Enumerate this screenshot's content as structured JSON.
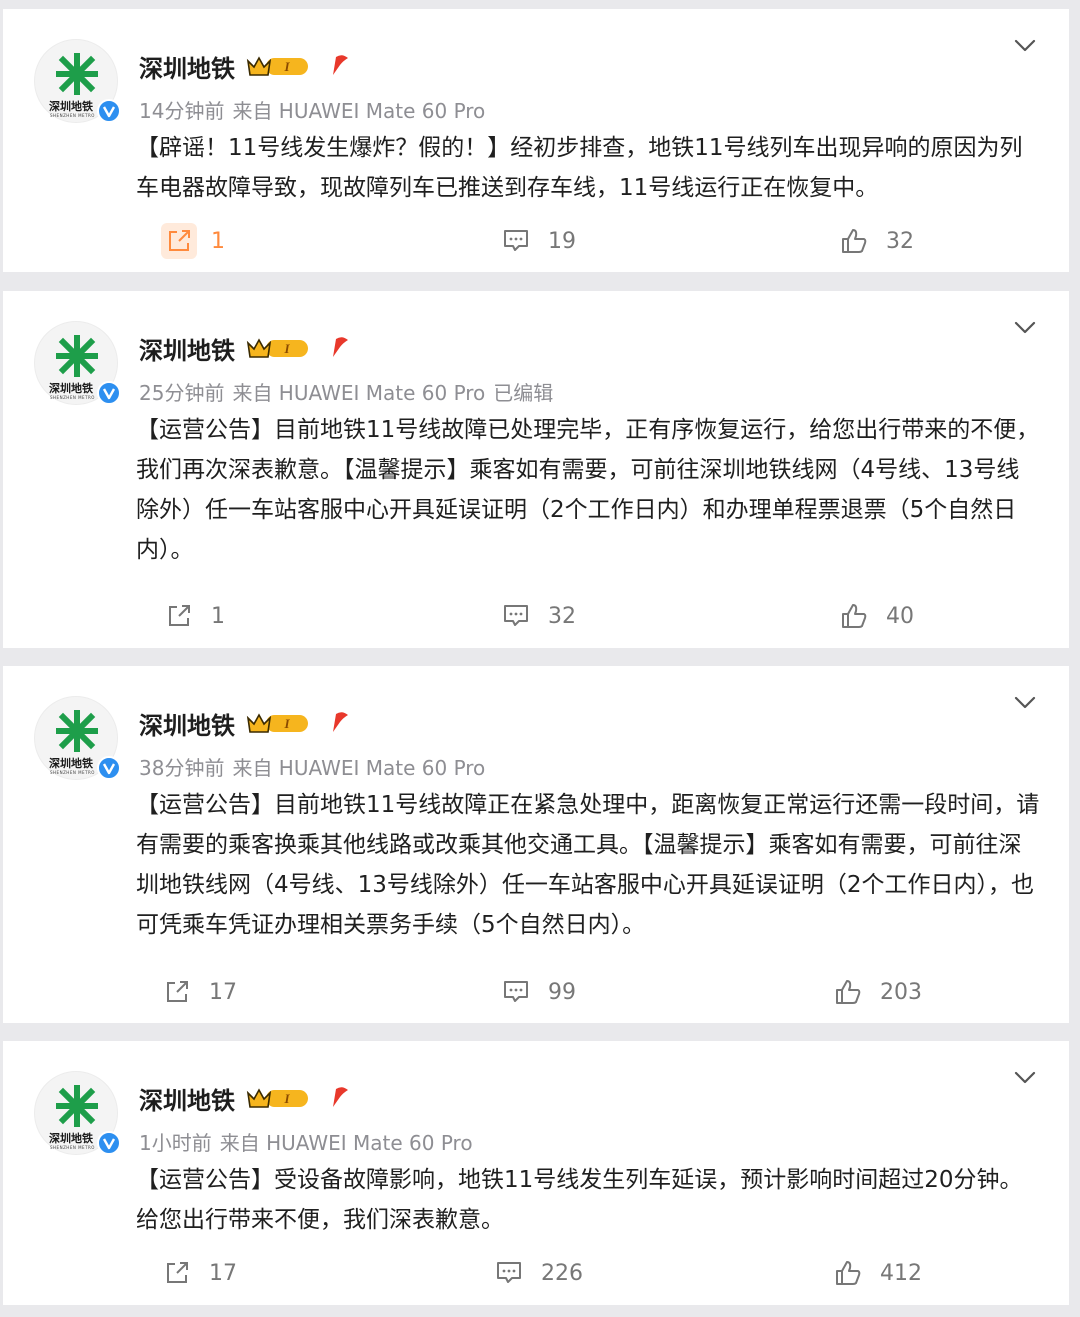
{
  "posts": [
    {
      "author": "深圳地铁",
      "vip_level": "I",
      "time": "14分钟前",
      "source": "来自 HUAWEI Mate 60 Pro",
      "edited": "",
      "content": "【辟谣！11号线发生爆炸？假的！】经初步排查，地铁11号线列车出现异响的原因为列车电器故障导致，现故障列车已推送到存车线，11号线运行正在恢复中。",
      "shares": "1",
      "comments": "19",
      "likes": "32"
    },
    {
      "author": "深圳地铁",
      "vip_level": "I",
      "time": "25分钟前",
      "source": "来自 HUAWEI Mate 60 Pro",
      "edited": "已编辑",
      "content": "【运营公告】目前地铁11号线故障已处理完毕，正有序恢复运行，给您出行带来的不便，我们再次深表歉意。【温馨提示】乘客如有需要，可前往深圳地铁线网（4号线、13号线除外）任一车站客服中心开具延误证明（2个工作日内）和办理单程票退票（5个自然日内）。",
      "shares": "1",
      "comments": "32",
      "likes": "40"
    },
    {
      "author": "深圳地铁",
      "vip_level": "I",
      "time": "38分钟前",
      "source": "来自 HUAWEI Mate 60 Pro",
      "edited": "",
      "content": "【运营公告】目前地铁11号线故障正在紧急处理中，距离恢复正常运行还需一段时间，请有需要的乘客换乘其他线路或改乘其他交通工具。【温馨提示】乘客如有需要，可前往深圳地铁线网（4号线、13号线除外）任一车站客服中心开具延误证明（2个工作日内），也可凭乘车凭证办理相关票务手续（5个自然日内）。",
      "shares": "17",
      "comments": "99",
      "likes": "203"
    },
    {
      "author": "深圳地铁",
      "vip_level": "I",
      "time": "1小时前",
      "source": "来自 HUAWEI Mate 60 Pro",
      "edited": "",
      "content": "【运营公告】受设备故障影响，地铁11号线发生列车延误，预计影响时间超过20分钟。给您出行带来不便，我们深表歉意。",
      "shares": "17",
      "comments": "226",
      "likes": "412"
    }
  ],
  "avatar": {
    "logo_text": "深圳地铁",
    "logo_sub": "SHENZHEN METRO"
  },
  "colors": {
    "accent_green": "#1e9e4a",
    "verified_blue": "#2d8ff0",
    "share_active": "#ff8a3d",
    "background": "#e9e9ec"
  },
  "icons": [
    "shenzhen-metro-logo",
    "verified-badge-icon",
    "vip-crown-icon",
    "fire-badge-icon",
    "chevron-down-icon",
    "share-icon",
    "comment-icon",
    "like-icon"
  ]
}
